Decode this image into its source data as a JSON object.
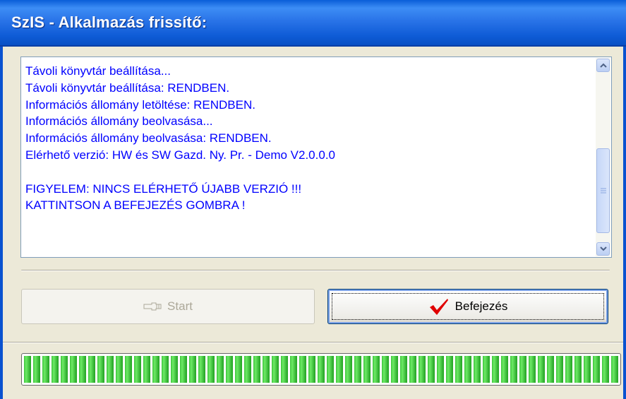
{
  "window": {
    "title": "SzIS - Alkalmazás frissítő:"
  },
  "log": {
    "lines": [
      "Távoli könyvtár beállítása...",
      "Távoli könyvtár beállítása: RENDBEN.",
      "Információs állomány letöltése: RENDBEN.",
      "Információs állomány beolvasása...",
      "Információs állomány beolvasása: RENDBEN.",
      "Elérhető verzió: HW és SW Gazd. Ny. Pr. - Demo V2.0.0.0",
      "",
      "FIGYELEM: NINCS ELÉRHETŐ ÚJABB VERZIÓ !!!",
      "KATTINTSON A BEFEJEZÉS GOMBRA !"
    ]
  },
  "buttons": {
    "start": {
      "label": "Start",
      "enabled": false,
      "icon": "hand-pointer-icon"
    },
    "finish": {
      "label": "Befejezés",
      "enabled": true,
      "icon": "checkmark-icon",
      "icon_color": "#e00000"
    }
  },
  "progress": {
    "value": 1.0,
    "color": "#3cc43a"
  },
  "colors": {
    "title_bar": "#0a5ed8",
    "log_text": "#0000ff"
  }
}
